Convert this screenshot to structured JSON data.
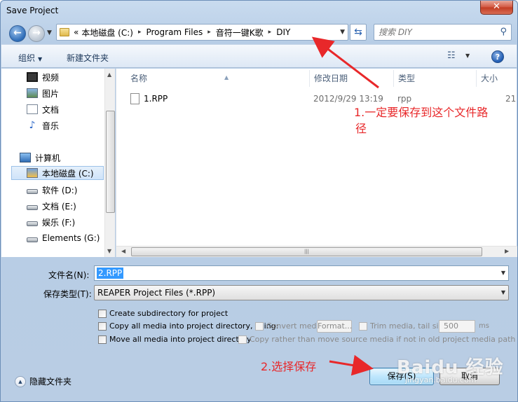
{
  "window": {
    "title": "Save Project",
    "close_glyph": "✕"
  },
  "nav": {
    "back_icon": "back-arrow-icon",
    "forward_icon": "forward-arrow-icon"
  },
  "address": {
    "prefix": "«",
    "crumbs": [
      "本地磁盘 (C:)",
      "Program Files",
      "音符一键K歌",
      "DIY"
    ],
    "separator": "▸"
  },
  "search": {
    "placeholder": "搜索 DIY"
  },
  "toolbar": {
    "organize": "组织",
    "new_folder": "新建文件夹"
  },
  "sidebar": {
    "items": [
      {
        "label": "视频",
        "icon": "video-icon"
      },
      {
        "label": "图片",
        "icon": "pictures-icon"
      },
      {
        "label": "文档",
        "icon": "documents-icon"
      },
      {
        "label": "音乐",
        "icon": "music-icon"
      },
      {
        "label": "计算机",
        "icon": "computer-icon"
      },
      {
        "label": "本地磁盘 (C:)",
        "icon": "windows-drive-icon",
        "selected": true
      },
      {
        "label": "软件 (D:)",
        "icon": "drive-icon"
      },
      {
        "label": "文档 (E:)",
        "icon": "drive-icon"
      },
      {
        "label": "娱乐 (F:)",
        "icon": "drive-icon"
      },
      {
        "label": "Elements (G:)",
        "icon": "drive-icon"
      }
    ]
  },
  "filelist": {
    "columns": [
      "名称",
      "修改日期",
      "类型",
      "大小"
    ],
    "rows": [
      {
        "name": "1.RPP",
        "date": "2012/9/29 13:19",
        "type": "rpp",
        "size": "21"
      }
    ]
  },
  "form": {
    "filename_label": "文件名(N):",
    "filename_value": "2.RPP",
    "filetype_label": "保存类型(T):",
    "filetype_value": "REAPER Project Files (*.RPP)"
  },
  "options": {
    "create_subdir": "Create subdirectory for project",
    "copy_media": "Copy all media into project directory, using:",
    "convert_media": "Convert media",
    "format_button": "Format...",
    "trim_media": "Trim media, tail size:",
    "tail_size": "500",
    "tail_unit": "ms",
    "move_media": "Move all media into project directory",
    "copy_rather": "Copy rather than move source media if not in old project media path"
  },
  "footer": {
    "hide_folders": "隐藏文件夹",
    "save_button": "保存(S)",
    "cancel_button": "取消"
  },
  "annotations": {
    "note1_line1": "1.一定要保存到这个文件路",
    "note1_line2": "径",
    "note2": "2.选择保存",
    "color": "#e8282a"
  },
  "watermark": {
    "main": "Baidu 经验",
    "sub": "jingyan.baidu.com"
  },
  "colors": {
    "selection": "#3399ff",
    "accent": "#2c6bb7",
    "annotation": "#e8282a"
  }
}
